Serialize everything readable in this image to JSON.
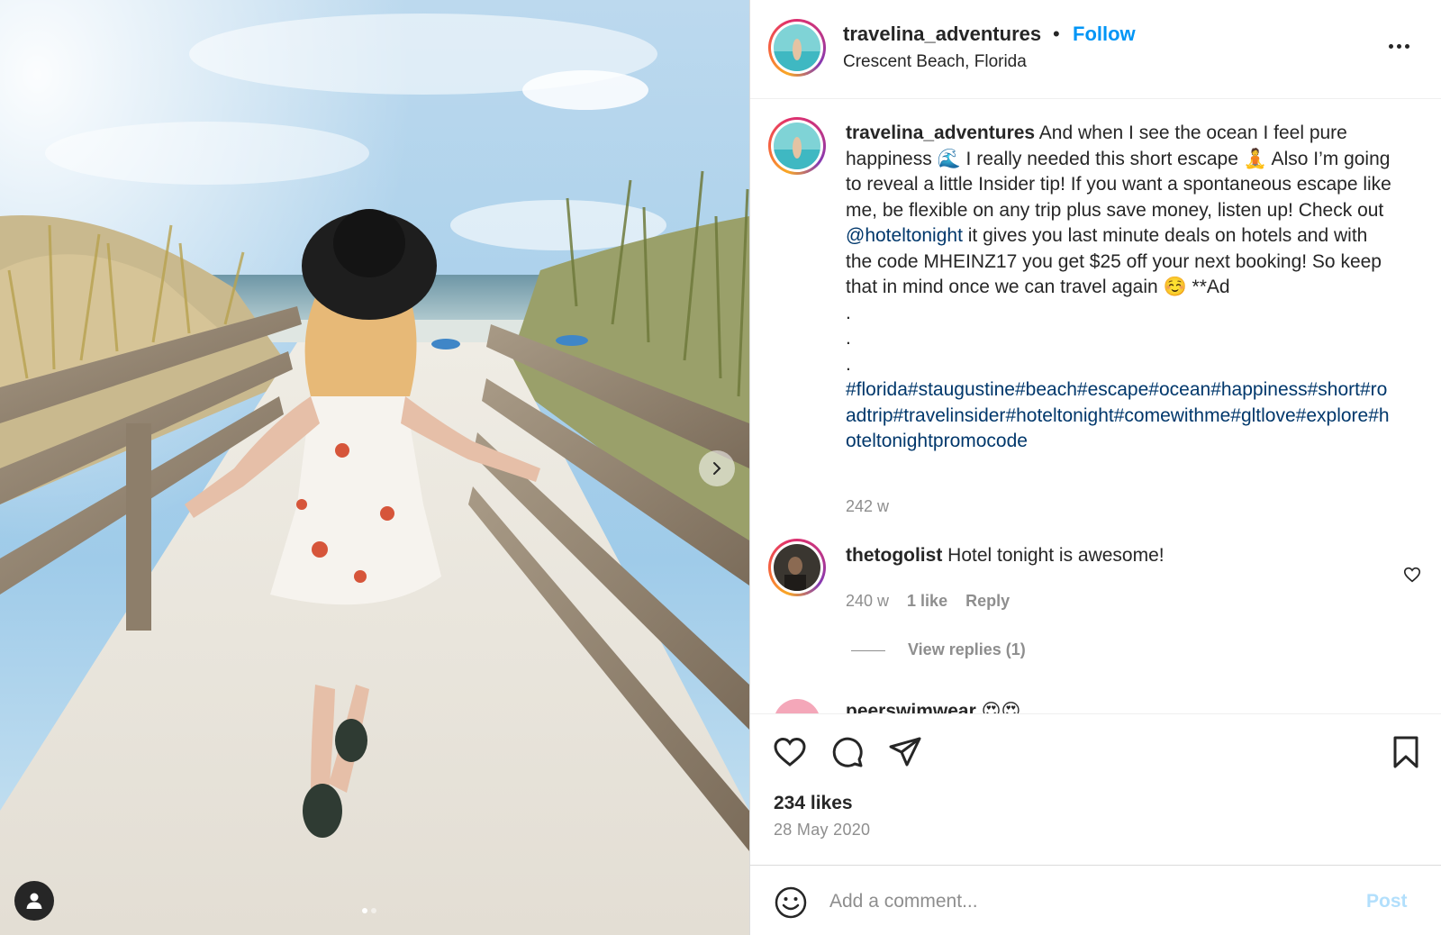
{
  "post": {
    "username": "travelina_adventures",
    "separator": "•",
    "follow_label": "Follow",
    "location": "Crescent Beach, Florida",
    "photo_alt": "Woman in a white floral dress and black hat walking down a boardwalk to the beach"
  },
  "caption": {
    "username": "travelina_adventures",
    "text_part1": " And when I see the ocean I feel pure happiness 🌊 I really needed this short escape 🧘 Also I’m going to reveal a little Insider tip! If you want a spontaneous escape like me, be flexible on any trip plus save money, listen up! Check out ",
    "mention": "@hoteltonight",
    "text_part2": " it gives you last minute deals on hotels and with the code MHEINZ17 you get $25 off your next booking! So keep that in mind once we can travel again ☺️ **Ad",
    "dots": [
      ".",
      ".",
      "."
    ],
    "hashtags": [
      "#florida",
      "#staugustine",
      "#beach",
      "#escape",
      "#ocean",
      "#happiness",
      "#short",
      "#roadtrip",
      "#travelinsider",
      "#hoteltonight",
      "#comewithme",
      "#gltlove",
      "#explore",
      "#hoteltonightpromocode"
    ],
    "time": "242 w"
  },
  "comments": [
    {
      "username": "thetogolist",
      "text": " Hotel tonight is awesome!",
      "time": "240 w",
      "likes": "1 like",
      "reply_label": "Reply",
      "view_replies": "View replies (1)"
    },
    {
      "username": "peerswimwear",
      "text": "😍😍"
    }
  ],
  "actions": {
    "icons": [
      "heart-icon",
      "comment-icon",
      "share-icon",
      "bookmark-icon"
    ],
    "likes": "234 likes",
    "date": "28 May 2020"
  },
  "add_comment": {
    "placeholder": "Add a comment...",
    "post_label": "Post"
  },
  "colors": {
    "follow": "#0095f6",
    "link": "#00376b",
    "muted": "#8e8e8e",
    "post_disabled": "#b2dffc"
  },
  "carousel": {
    "current_slide": 1,
    "total_slides": 2
  }
}
